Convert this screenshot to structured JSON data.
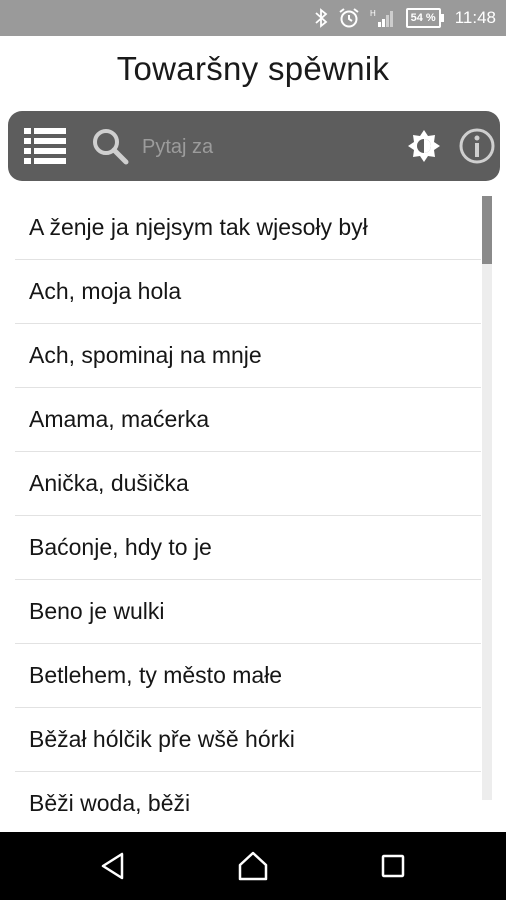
{
  "status_bar": {
    "battery": "54 %",
    "time": "11:48",
    "icons": [
      "bluetooth-icon",
      "alarm-icon",
      "signal-icon",
      "battery-icon"
    ]
  },
  "app": {
    "title": "Towaršny spěwnik"
  },
  "toolbar": {
    "search_placeholder": "Pytaj za",
    "icons": [
      "menu-list-icon",
      "search-icon",
      "brightness-icon",
      "info-icon"
    ]
  },
  "songs": [
    "A ženje ja njejsym tak wjesoły był",
    "Ach, moja hola",
    "Ach, spominaj na mnje",
    "Amama, maćerka",
    "Anička, dušička",
    "Baćonje, hdy to je",
    "Beno je wulki",
    "Betlehem, ty město małe",
    "Běžał hólčik pře wšě hórki",
    "Běži woda, běži"
  ],
  "nav_bar": {
    "icons": [
      "back-icon",
      "home-icon",
      "recent-apps-icon"
    ]
  },
  "colors": {
    "status_bar": "#9a9a9a",
    "toolbar": "#5d5d5d",
    "background": "#ffffff",
    "nav_bar": "#000000"
  }
}
